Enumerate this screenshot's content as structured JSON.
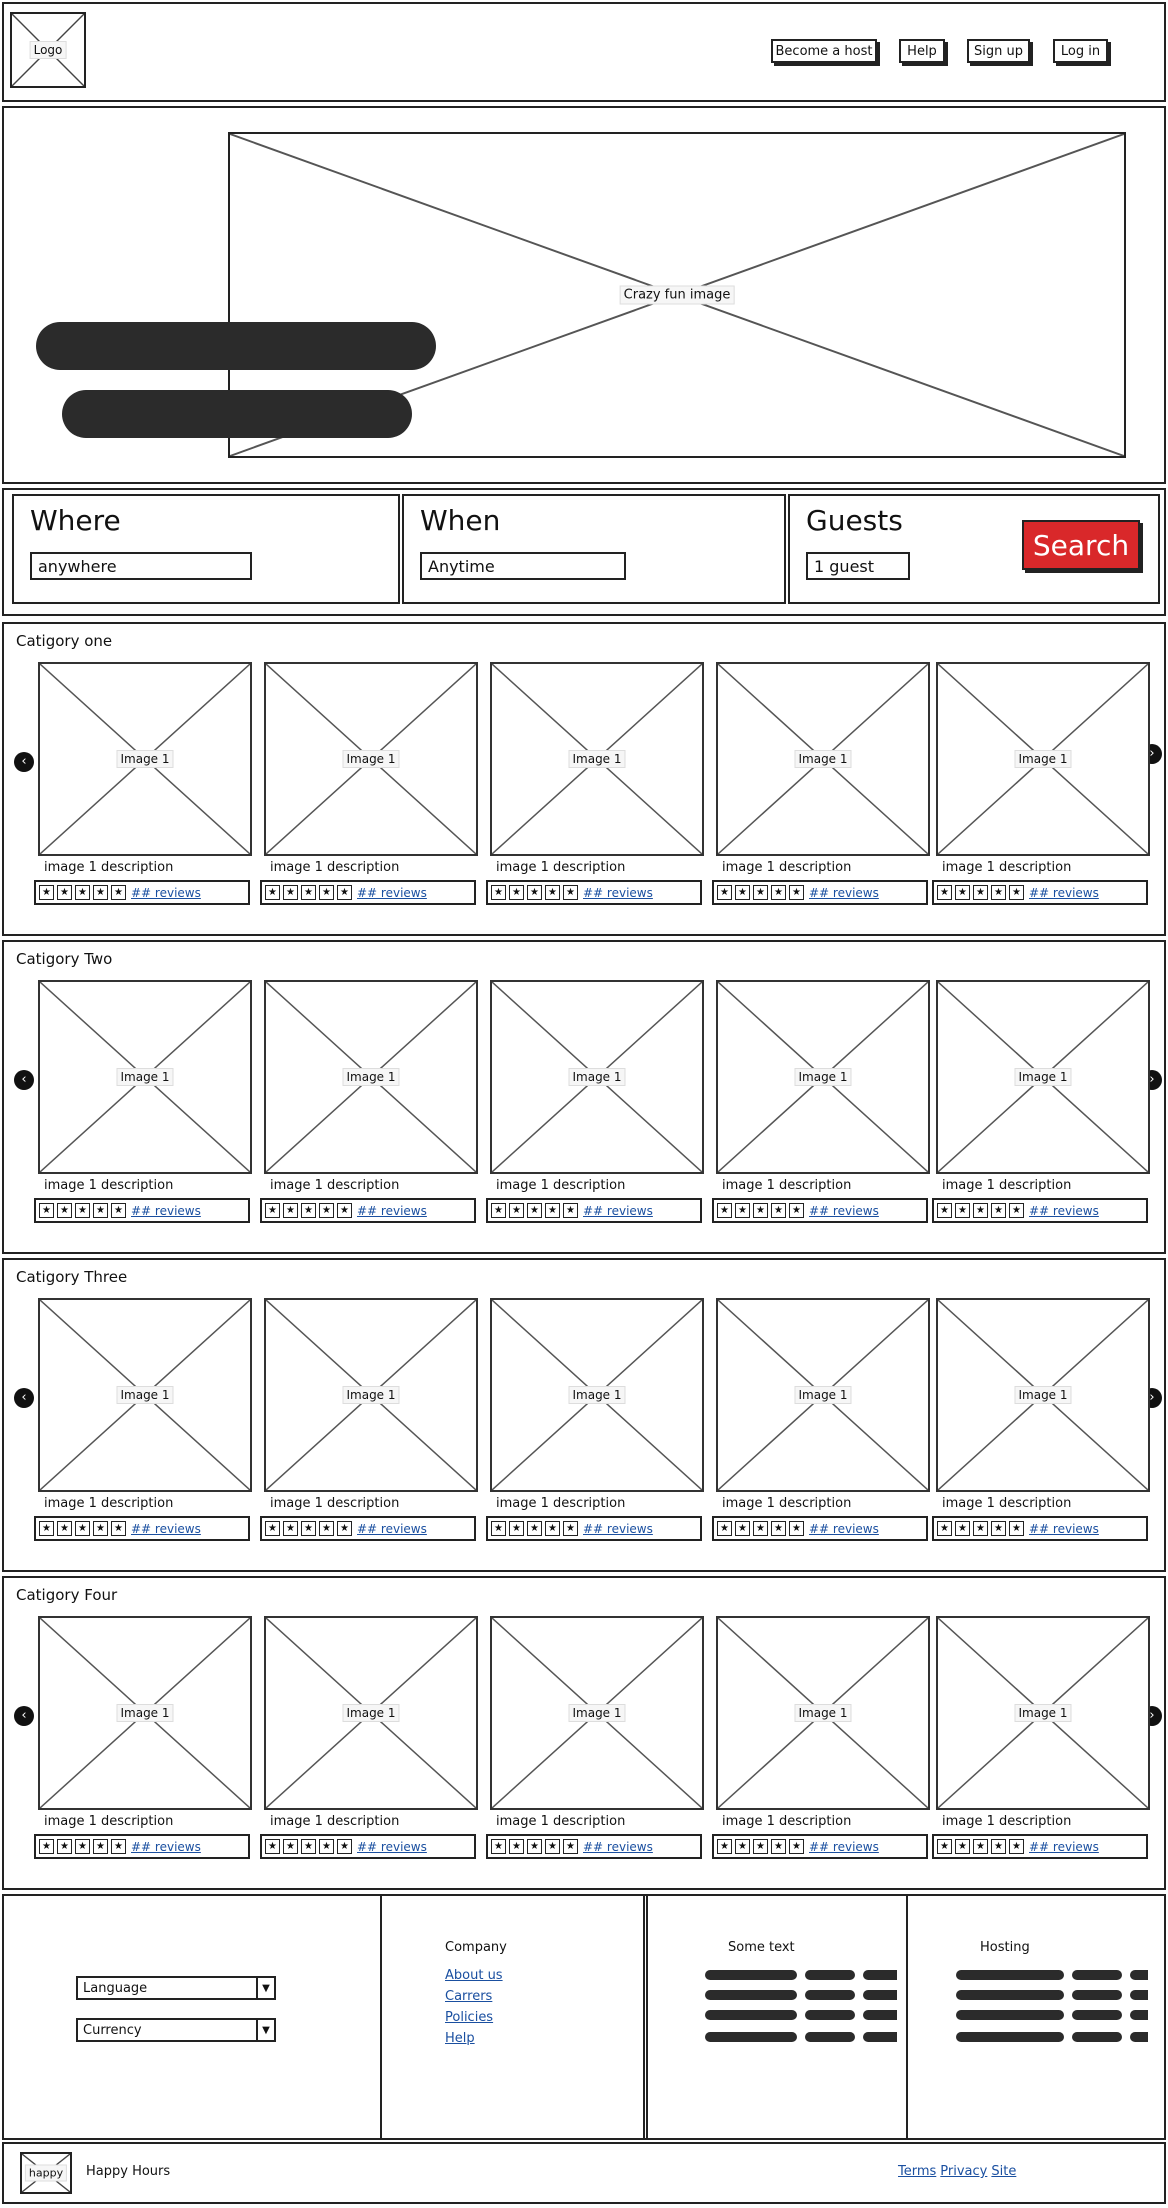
{
  "header": {
    "logo_label": "Logo",
    "nav": [
      "Become a host",
      "Help",
      "Sign up",
      "Log in"
    ]
  },
  "hero": {
    "image_label": "Crazy fun image"
  },
  "search": {
    "where": {
      "label": "Where",
      "value": "anywhere"
    },
    "when": {
      "label": "When",
      "value": "Anytime"
    },
    "guests": {
      "label": "Guests",
      "value": "1 guest"
    },
    "button_label": "Search",
    "button_color": "#d9282a"
  },
  "categories": [
    {
      "title": "Catigory one"
    },
    {
      "title": "Catigory Two"
    },
    {
      "title": "Catigory Three"
    },
    {
      "title": "Catigory Four"
    }
  ],
  "card": {
    "image_label": "Image 1",
    "description": "image 1 description",
    "reviews_label": "## reviews",
    "star_glyph": "★"
  },
  "arrows": {
    "prev": "‹",
    "next": "›"
  },
  "footer": {
    "language_label": "Language",
    "currency_label": "Currency",
    "company_heading": "Company",
    "company_links": [
      "About us",
      "Carrers",
      "Policies",
      "Help"
    ],
    "some_text_heading": "Some text",
    "hosting_heading": "Hosting"
  },
  "bottom_bar": {
    "logo_label": "happy",
    "brand": "Happy Hours",
    "links": [
      "Terms",
      "Privacy",
      "Site"
    ]
  }
}
